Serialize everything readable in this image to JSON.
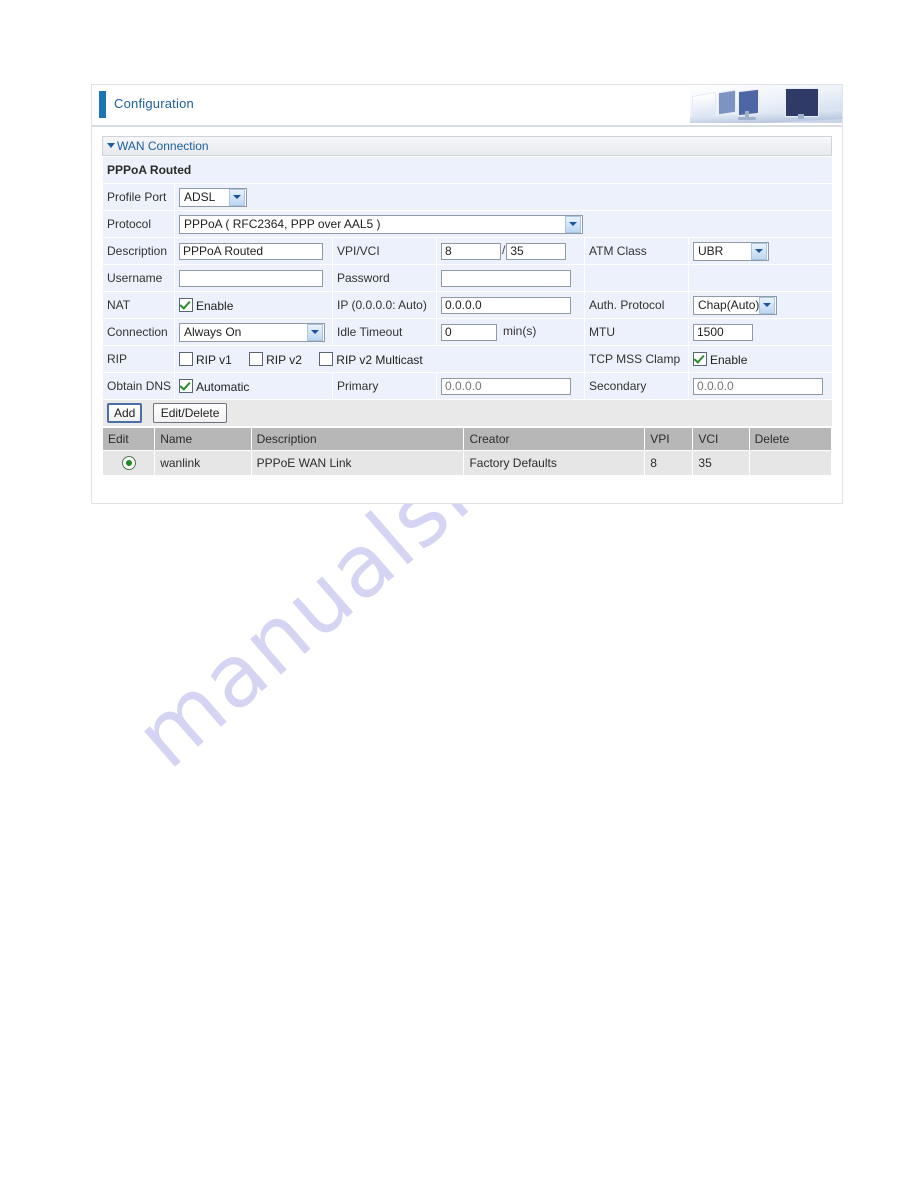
{
  "header": {
    "title": "Configuration",
    "accent_color": "#1b76b5",
    "art_name": "office-desks-monitors-artwork"
  },
  "section": {
    "title": "WAN Connection",
    "subtitle": "PPPoA Routed"
  },
  "form": {
    "profile_port": {
      "label": "Profile Port",
      "value": "ADSL"
    },
    "protocol": {
      "label": "Protocol",
      "value": "PPPoA ( RFC2364, PPP over AAL5 )"
    },
    "description": {
      "label": "Description",
      "value": "PPPoA Routed"
    },
    "vpivci": {
      "label": "VPI/VCI",
      "vpi": "8",
      "vci": "35",
      "separator": "/"
    },
    "atm_class": {
      "label": "ATM Class",
      "value": "UBR"
    },
    "username": {
      "label": "Username",
      "value": ""
    },
    "password": {
      "label": "Password",
      "value": ""
    },
    "nat": {
      "label": "NAT",
      "checkbox_label": "Enable",
      "checked": true
    },
    "ip": {
      "label": "IP (0.0.0.0: Auto)",
      "value": "0.0.0.0"
    },
    "auth_protocol": {
      "label": "Auth. Protocol",
      "value": "Chap(Auto)"
    },
    "connection": {
      "label": "Connection",
      "value": "Always On"
    },
    "idle_timeout": {
      "label": "Idle Timeout",
      "value": "0",
      "unit": "min(s)"
    },
    "mtu": {
      "label": "MTU",
      "value": "1500"
    },
    "rip": {
      "label": "RIP",
      "options": [
        {
          "label": "RIP v1",
          "checked": false
        },
        {
          "label": "RIP v2",
          "checked": false
        },
        {
          "label": "RIP v2 Multicast",
          "checked": false
        }
      ]
    },
    "tcp_mss_clamp": {
      "label": "TCP MSS Clamp",
      "checkbox_label": "Enable",
      "checked": true
    },
    "obtain_dns": {
      "label": "Obtain DNS",
      "checkbox_label": "Automatic",
      "checked": true
    },
    "dns_primary": {
      "label": "Primary",
      "placeholder": "0.0.0.0",
      "value": "0.0.0.0"
    },
    "dns_secondary": {
      "label": "Secondary",
      "placeholder": "0.0.0.0",
      "value": "0.0.0.0"
    }
  },
  "buttons": {
    "add": "Add",
    "edit_delete": "Edit/Delete"
  },
  "table": {
    "columns": [
      "Edit",
      "Name",
      "Description",
      "Creator",
      "VPI",
      "VCI",
      "Delete"
    ],
    "rows": [
      {
        "edit_selected": true,
        "name": "wanlink",
        "description": "PPPoE WAN Link",
        "creator": "Factory Defaults",
        "vpi": "8",
        "vci": "35",
        "delete": ""
      }
    ]
  },
  "watermark": {
    "text": "manualshive.com",
    "color": "#cfcdf2"
  }
}
